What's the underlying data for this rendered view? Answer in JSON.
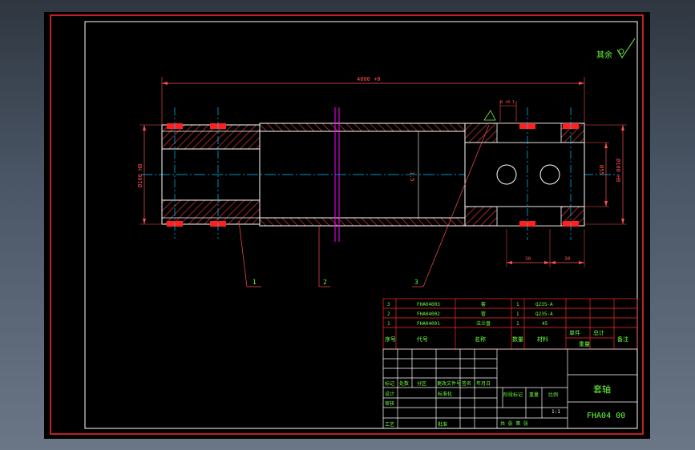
{
  "colors": {
    "frame": "#ff2a2a",
    "line": "#ffffff",
    "dim": "#ff5050",
    "center": "#00c8ff",
    "hatch": "#ff4040",
    "text": "#6cff3a",
    "accent": "#ff00ff",
    "seal": "#ff2020"
  },
  "drawing": {
    "overall_length": "4000 +0",
    "inner_label": "1.5",
    "left_diameter": "Ø100 H8",
    "right_diameter": "Ø100 H8",
    "right_bore": "Ø55",
    "top_small_dim": "8 +0.1",
    "bottom_dim_left": "30",
    "bottom_dim_right": "30",
    "callouts": [
      "1",
      "2",
      "3"
    ],
    "roughness": "其余"
  },
  "bom": {
    "rows": [
      {
        "no": "3",
        "code": "FHA04003",
        "name": "套",
        "qty": "1",
        "material": "Q235-A"
      },
      {
        "no": "2",
        "code": "FHA04002",
        "name": "管",
        "qty": "1",
        "material": "Q235-A"
      },
      {
        "no": "1",
        "code": "FHA04001",
        "name": "法兰盘",
        "qty": "1",
        "material": "45"
      }
    ],
    "header": {
      "no": "序号",
      "code": "代号",
      "name": "名称",
      "qty": "数量",
      "material": "材料",
      "single": "单件",
      "total": "总计",
      "weight": "重量",
      "remark": "备注"
    }
  },
  "titleblock": {
    "title": "套轴",
    "drawing_no": "FHA04 00",
    "scale": "1:1",
    "labels": {
      "mark": "标记",
      "count": "处数",
      "zone": "分区",
      "change_doc": "更改文件号",
      "sign": "签名",
      "date": "年月日",
      "design": "设计",
      "standard": "标准化",
      "check": "审核",
      "process": "工艺",
      "approve": "批准",
      "stage_mark": "阶段标记",
      "weight": "重量",
      "ratio": "比例",
      "sheets": "共 张 第 张"
    }
  }
}
